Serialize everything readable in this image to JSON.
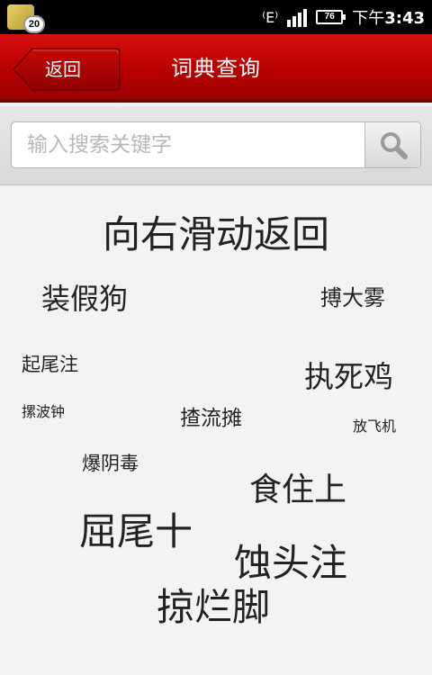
{
  "status_bar": {
    "notification_count": "20",
    "network_icon": "⁽E⁾",
    "battery_level": "76",
    "time_prefix": "下午",
    "time": "3:43",
    "icons": [
      "notification-app-icon",
      "network-e-icon",
      "signal-icon",
      "battery-icon"
    ]
  },
  "header": {
    "back_label": "返回",
    "title": "词典查询",
    "color": "#c40505"
  },
  "search": {
    "placeholder": "输入搜索关键字",
    "value": ""
  },
  "cloud": {
    "hint": "向右滑动返回",
    "words": [
      "装假狗",
      "搏大雾",
      "起尾注",
      "执死鸡",
      "摞波钟",
      "揸流摊",
      "放飞机",
      "爆阴毒",
      "食住上",
      "屈尾十",
      "蚀头注",
      "掠烂脚"
    ]
  }
}
